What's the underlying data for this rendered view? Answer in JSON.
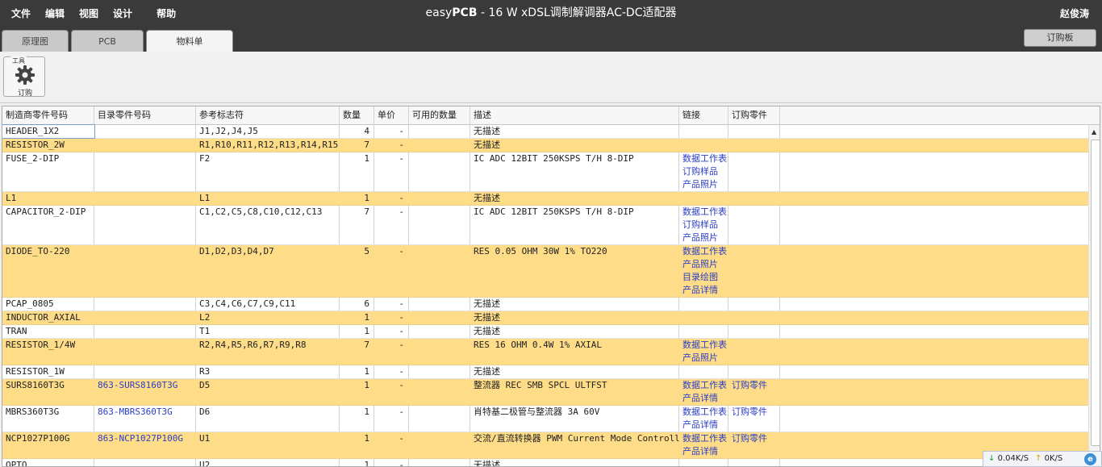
{
  "menu": {
    "file": "文件",
    "edit": "编辑",
    "view": "视图",
    "design": "设计",
    "help": "帮助"
  },
  "title_prefix": "easy",
  "title_bold": "PCB",
  "title_rest": " - 16 W xDSL调制解调器AC-DC适配器",
  "user": "赵俊涛",
  "tabs": [
    "原理图",
    "PCB",
    "物料单"
  ],
  "order_board": "订购板",
  "toolbar": {
    "group_label": "工具",
    "order_label": "订购",
    "icon": "gear-icon"
  },
  "columns": [
    "制造商零件号码",
    "目录零件号码",
    "参考标志符",
    "数量",
    "单价",
    "可用的数量",
    "描述",
    "链接",
    "订购零件"
  ],
  "rows": [
    {
      "mfr": "HEADER_1X2",
      "cat": "",
      "ref": "J1,J2,J4,J5",
      "qty": "4",
      "price": "-",
      "avail": "",
      "desc": "无描述",
      "links": [],
      "order": ""
    },
    {
      "mfr": "RESISTOR_2W",
      "cat": "",
      "ref": "R1,R10,R11,R12,R13,R14,R15",
      "qty": "7",
      "price": "-",
      "avail": "",
      "desc": "无描述",
      "links": [],
      "order": ""
    },
    {
      "mfr": "FUSE_2-DIP",
      "cat": "",
      "ref": "F2",
      "qty": "1",
      "price": "-",
      "avail": "",
      "desc": "IC ADC 12BIT 250KSPS T/H 8-DIP",
      "links": [
        "数据工作表",
        "订购样品",
        "产品照片"
      ],
      "order": ""
    },
    {
      "mfr": "L1",
      "cat": "",
      "ref": "L1",
      "qty": "1",
      "price": "-",
      "avail": "",
      "desc": "无描述",
      "links": [],
      "order": ""
    },
    {
      "mfr": "CAPACITOR_2-DIP",
      "cat": "",
      "ref": "C1,C2,C5,C8,C10,C12,C13",
      "qty": "7",
      "price": "-",
      "avail": "",
      "desc": "IC ADC 12BIT 250KSPS T/H 8-DIP",
      "links": [
        "数据工作表",
        "订购样品",
        "产品照片"
      ],
      "order": ""
    },
    {
      "mfr": "DIODE_TO-220",
      "cat": "",
      "ref": "D1,D2,D3,D4,D7",
      "qty": "5",
      "price": "-",
      "avail": "",
      "desc": "RES 0.05 OHM 30W 1% TO220",
      "links": [
        "数据工作表",
        "产品照片",
        "目录绘图",
        "产品详情"
      ],
      "order": ""
    },
    {
      "mfr": "PCAP_0805",
      "cat": "",
      "ref": "C3,C4,C6,C7,C9,C11",
      "qty": "6",
      "price": "-",
      "avail": "",
      "desc": "无描述",
      "links": [],
      "order": ""
    },
    {
      "mfr": "INDUCTOR_AXIAL",
      "cat": "",
      "ref": "L2",
      "qty": "1",
      "price": "-",
      "avail": "",
      "desc": "无描述",
      "links": [],
      "order": ""
    },
    {
      "mfr": "TRAN",
      "cat": "",
      "ref": "T1",
      "qty": "1",
      "price": "-",
      "avail": "",
      "desc": "无描述",
      "links": [],
      "order": ""
    },
    {
      "mfr": "RESISTOR_1/4W",
      "cat": "",
      "ref": "R2,R4,R5,R6,R7,R9,R8",
      "qty": "7",
      "price": "-",
      "avail": "",
      "desc": "RES 16 OHM 0.4W 1% AXIAL",
      "links": [
        "数据工作表",
        "产品照片"
      ],
      "order": ""
    },
    {
      "mfr": "RESISTOR_1W",
      "cat": "",
      "ref": "R3",
      "qty": "1",
      "price": "-",
      "avail": "",
      "desc": "无描述",
      "links": [],
      "order": ""
    },
    {
      "mfr": "SURS8160T3G",
      "cat": "863-SURS8160T3G",
      "ref": "D5",
      "qty": "1",
      "price": "-",
      "avail": "",
      "desc": "整流器 REC SMB SPCL ULTFST",
      "links": [
        "数据工作表",
        "产品详情"
      ],
      "order": "订购零件"
    },
    {
      "mfr": "MBRS360T3G",
      "cat": "863-MBRS360T3G",
      "ref": "D6",
      "qty": "1",
      "price": "-",
      "avail": "",
      "desc": "肖特基二极管与整流器 3A 60V",
      "links": [
        "数据工作表",
        "产品详情"
      ],
      "order": "订购零件"
    },
    {
      "mfr": "NCP1027P100G",
      "cat": "863-NCP1027P100G",
      "ref": "U1",
      "qty": "1",
      "price": "-",
      "avail": "",
      "desc": "交流/直流转换器 PWM Current Mode Controller",
      "links": [
        "数据工作表",
        "产品详情"
      ],
      "order": "订购零件"
    },
    {
      "mfr": "OPTO",
      "cat": "",
      "ref": "U2",
      "qty": "1",
      "price": "-",
      "avail": "",
      "desc": "无描述",
      "links": [],
      "order": ""
    }
  ],
  "status": {
    "down": "0.04K/S",
    "up": "0K/S"
  }
}
